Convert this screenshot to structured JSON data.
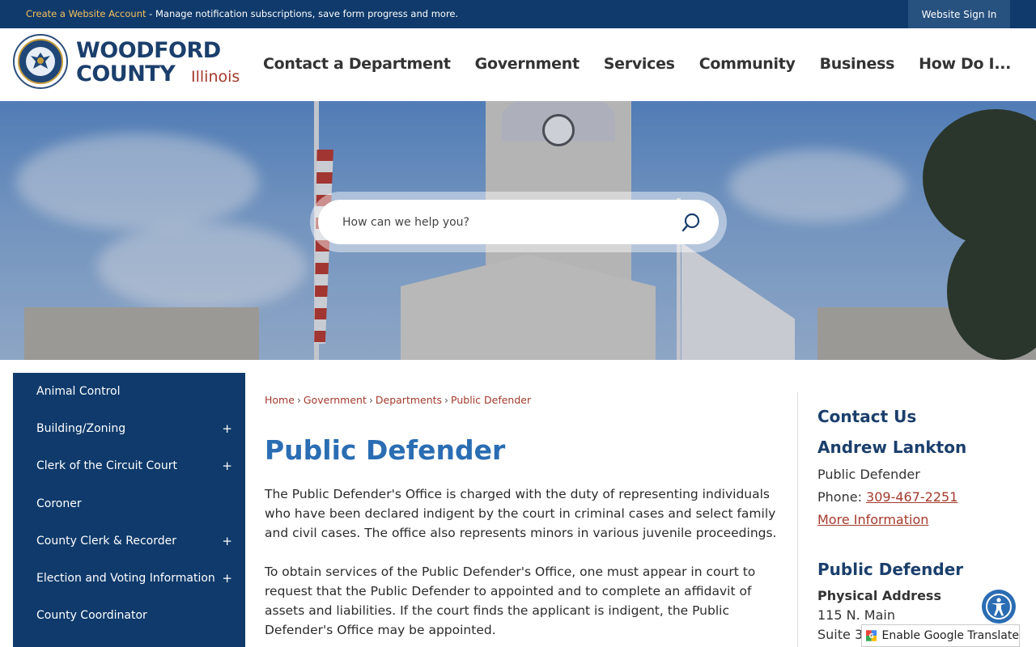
{
  "topbar": {
    "create_account_link": "Create a Website Account",
    "message": " - Manage notification subscriptions, save form progress and more.",
    "sign_in_label": "Website Sign In"
  },
  "header": {
    "logo_line1": "WOODFORD",
    "logo_line2": "COUNTY",
    "logo_state": "Illinois",
    "seal_icon": "county-seal-icon"
  },
  "nav": {
    "items": [
      {
        "label": "Contact a Department"
      },
      {
        "label": "Government"
      },
      {
        "label": "Services"
      },
      {
        "label": "Community"
      },
      {
        "label": "Business"
      },
      {
        "label": "How Do I..."
      }
    ]
  },
  "search": {
    "placeholder": "How can we help you?",
    "icon": "search-icon"
  },
  "sidebar": {
    "items": [
      {
        "label": "Animal Control",
        "expandable": false
      },
      {
        "label": "Building/Zoning",
        "expandable": true
      },
      {
        "label": "Clerk of the Circuit Court",
        "expandable": true
      },
      {
        "label": "Coroner",
        "expandable": false
      },
      {
        "label": "County Clerk & Recorder",
        "expandable": true
      },
      {
        "label": "Election and Voting Information",
        "expandable": true
      },
      {
        "label": "County Coordinator",
        "expandable": false
      }
    ],
    "expand_symbol": "+"
  },
  "breadcrumb": {
    "items": [
      "Home",
      "Government",
      "Departments",
      "Public Defender"
    ],
    "separator": "›"
  },
  "main": {
    "title": "Public Defender",
    "paragraph1": "The Public Defender's Office is charged with the duty of representing individuals who have been declared indigent by the court in criminal cases and select family and civil cases. The office also represents minors in various juvenile proceedings.",
    "paragraph2": "To obtain services of the Public Defender's Office, one must appear in court to request that the Public Defender to appointed and to complete an affidavit of assets and liabilities. If the court finds the applicant is indigent, the Public Defender's Office may be appointed."
  },
  "contact": {
    "heading": "Contact Us",
    "name": "Andrew Lankton",
    "role": "Public Defender",
    "phone_label": "Phone: ",
    "phone": "309-467-2251",
    "more_info": "More Information",
    "office_heading": "Public Defender",
    "address_label": "Physical Address",
    "address_line1": "115 N. Main",
    "address_line2": "Suite 3"
  },
  "widgets": {
    "accessibility_icon": "accessibility-icon",
    "translate_label": "Enable Google Translate",
    "translate_icon": "google-translate-icon"
  },
  "colors": {
    "brand_navy": "#0f3a6b",
    "title_blue": "#2a6db3",
    "link_red": "#a33a2c",
    "accent_gold": "#f5c15a"
  }
}
